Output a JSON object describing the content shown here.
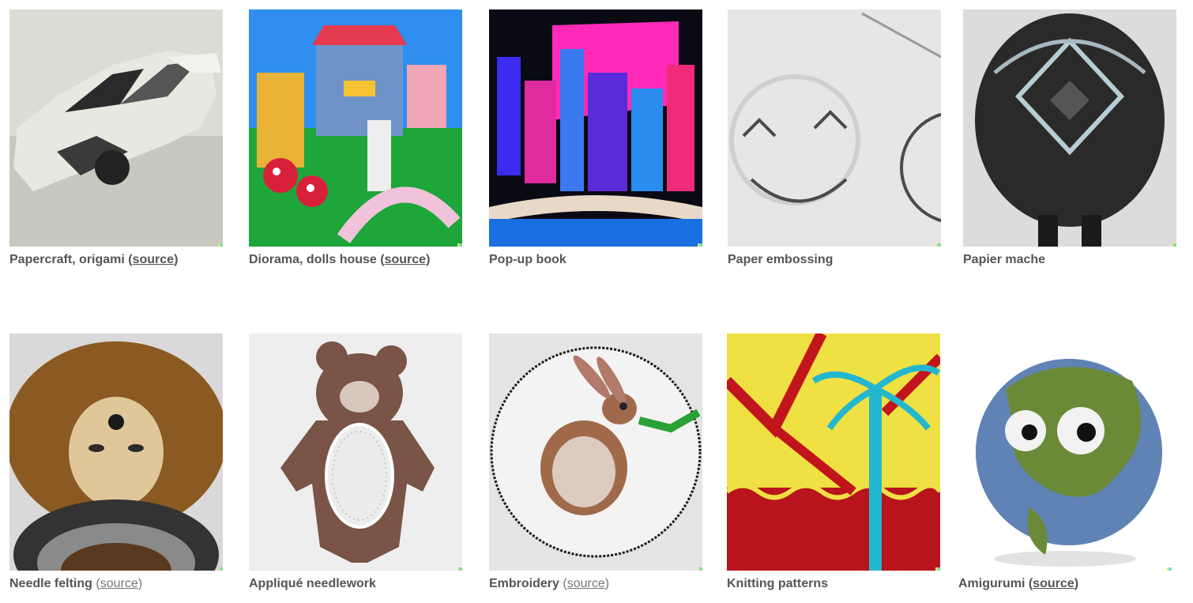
{
  "tiles": [
    {
      "title": "Papercraft, origami",
      "link": "source",
      "image": "papercraft-car-image"
    },
    {
      "title": "Diorama, dolls house",
      "link": "source",
      "image": "diorama-house-image"
    },
    {
      "title": "Pop-up book",
      "link": "",
      "image": "popup-book-city-image"
    },
    {
      "title": "Paper embossing",
      "link": "",
      "image": "embossed-smiley-image"
    },
    {
      "title": "Papier mache",
      "link": "",
      "image": "papier-mache-helmet-image"
    },
    {
      "title": "Needle felting",
      "link": "source",
      "image": "felted-figure-image"
    },
    {
      "title": "Appliqué needlework",
      "link": "",
      "image": "applique-bear-image"
    },
    {
      "title": "Embroidery",
      "link": "source",
      "image": "embroidered-rabbit-image"
    },
    {
      "title": "Knitting patterns",
      "link": "",
      "image": "knitted-palm-image"
    },
    {
      "title": "Amigurumi",
      "link": "source",
      "image": "amigurumi-earth-image"
    }
  ],
  "colors": {
    "caption": "#555555",
    "signature": [
      "#f6e94a",
      "#6fe0f5",
      "#7be37b",
      "#f66a5a",
      "#4a63f6"
    ]
  }
}
